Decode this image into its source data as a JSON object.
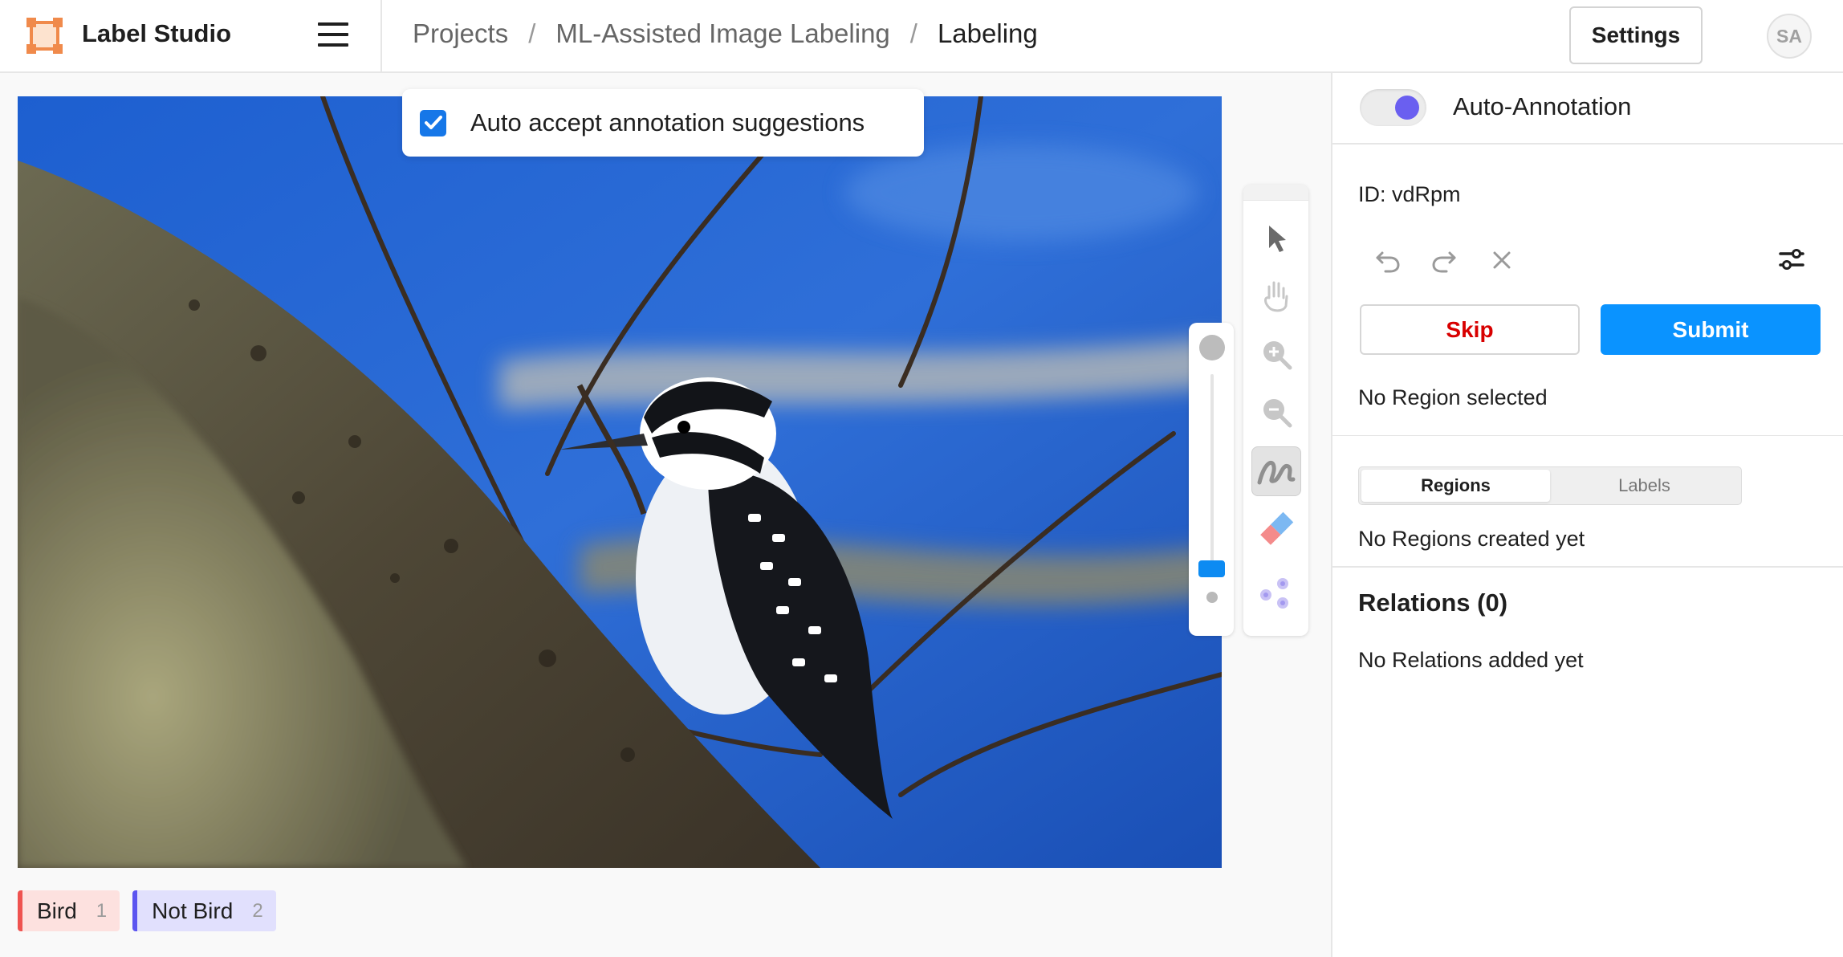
{
  "app": {
    "title": "Label Studio",
    "brand_color": "#f08a4b"
  },
  "breadcrumb": {
    "items": [
      "Projects",
      "ML-Assisted Image Labeling",
      "Labeling"
    ],
    "separator": "/"
  },
  "header": {
    "settings_label": "Settings",
    "avatar_initials": "SA"
  },
  "canvas": {
    "auto_accept": {
      "label": "Auto accept annotation suggestions",
      "checked": true
    },
    "tools": [
      "pointer-icon",
      "hand-icon",
      "zoom-in-icon",
      "zoom-out-icon",
      "brush-icon",
      "eraser-icon",
      "magic-wand-icon"
    ],
    "active_tool": "brush-icon",
    "brush_size_level": 0.1
  },
  "labels": [
    {
      "name": "Bird",
      "key": "1",
      "color": "#ef5350"
    },
    {
      "name": "Not Bird",
      "key": "2",
      "color": "#5c55f0"
    }
  ],
  "panel": {
    "auto_annotation": {
      "label": "Auto-Annotation",
      "enabled": true
    },
    "id_text": "ID: vdRpm",
    "skip_label": "Skip",
    "submit_label": "Submit",
    "no_region_selected": "No Region selected",
    "tabs": [
      {
        "label": "Regions",
        "active": true
      },
      {
        "label": "Labels",
        "active": false
      }
    ],
    "no_regions": "No Regions created yet",
    "relations_title": "Relations (0)",
    "no_relations": "No Relations added yet"
  }
}
